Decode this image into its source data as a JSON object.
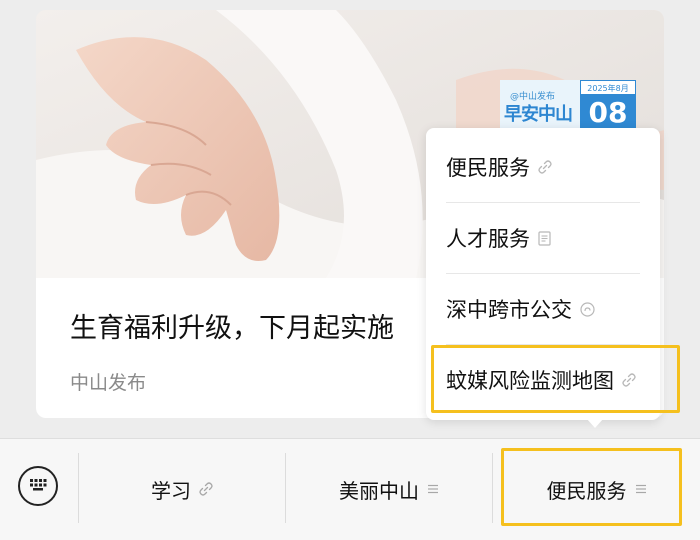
{
  "article": {
    "title": "生育福利升级，下月起实施",
    "source": "中山发布"
  },
  "badge": {
    "org": "@中山发布",
    "slogan": "早安中山",
    "month": "2025年8月",
    "day": "08"
  },
  "popup_menu": {
    "items": [
      {
        "label": "便民服务",
        "icon": "link-icon"
      },
      {
        "label": "人才服务",
        "icon": "document-icon"
      },
      {
        "label": "深中跨市公交",
        "icon": "mini-program-icon"
      },
      {
        "label": "蚊媒风险监测地图",
        "icon": "link-icon"
      }
    ]
  },
  "bottom_tabs": [
    {
      "label": "学习",
      "icon": "link-icon"
    },
    {
      "label": "美丽中山",
      "icon": "menu-icon"
    },
    {
      "label": "便民服务",
      "icon": "menu-icon"
    }
  ],
  "colors": {
    "highlight": "#f5c01e",
    "background": "#ededed",
    "badge_blue": "#2f89d3"
  }
}
